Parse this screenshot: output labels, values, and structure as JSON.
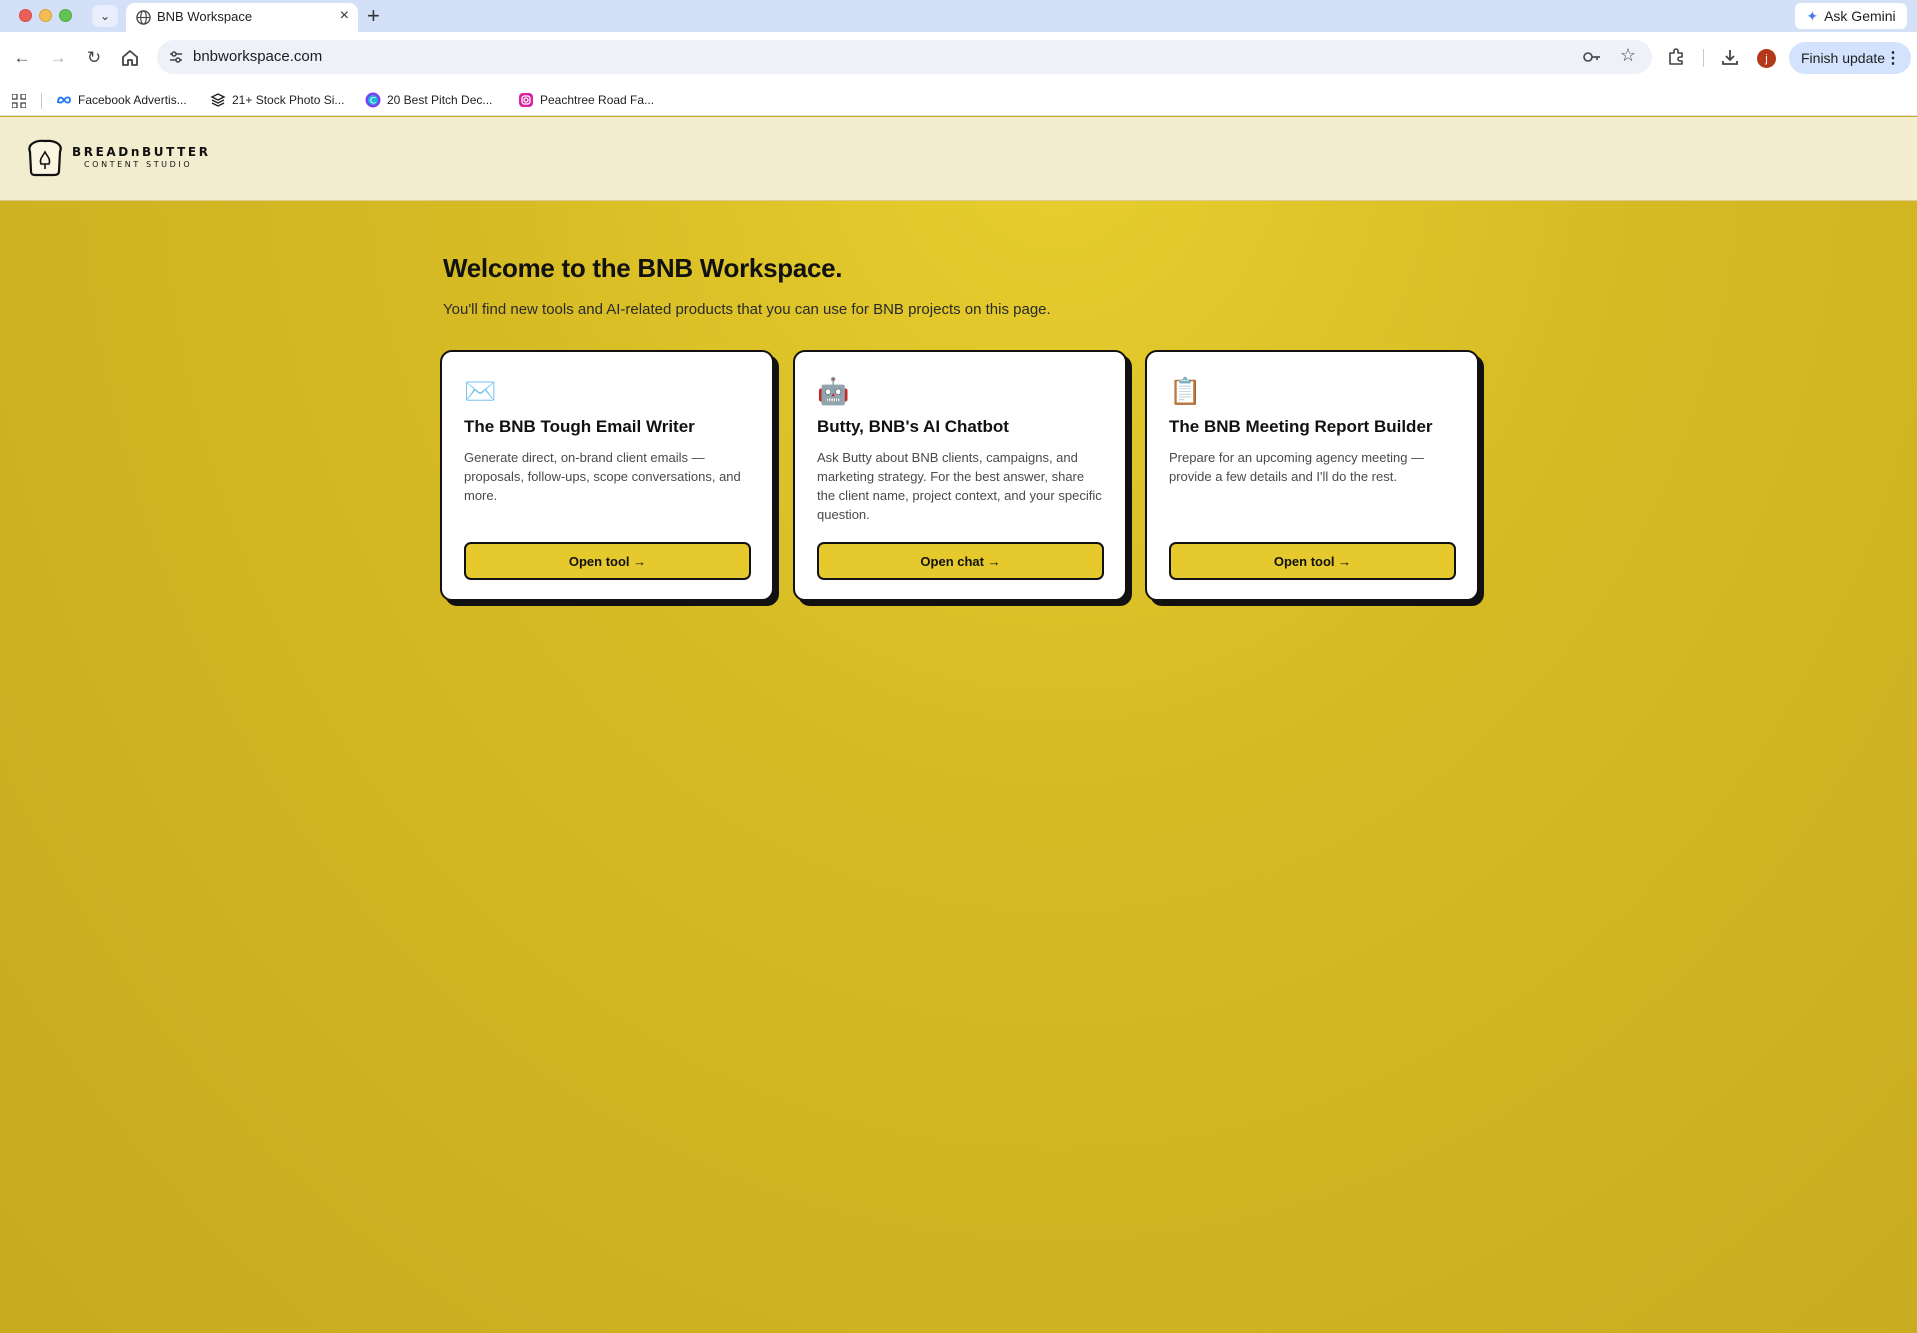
{
  "browser": {
    "tab_title": "BNB Workspace",
    "ask_gemini_label": "Ask Gemini",
    "url": "bnbworkspace.com",
    "finish_update_label": "Finish update",
    "profile_initial": "j",
    "bookmarks": [
      {
        "label": "Facebook Advertis...",
        "icon": "meta-icon"
      },
      {
        "label": "21+ Stock Photo Si...",
        "icon": "stack-icon"
      },
      {
        "label": "20 Best Pitch Dec...",
        "icon": "canva-icon"
      },
      {
        "label": "Peachtree Road Fa...",
        "icon": "instagram-icon"
      }
    ]
  },
  "site": {
    "logo": {
      "line1": "BREADnBUTTER",
      "line2": "CONTENT STUDIO"
    },
    "heading": "Welcome to the BNB Workspace.",
    "intro": "You'll find new tools and AI-related products that you can use for BNB projects on this page.",
    "accent_color": "#e6c92d",
    "cards": [
      {
        "icon": "envelope-icon",
        "emoji": "✉️",
        "title": "The BNB Tough Email Writer",
        "description": "Generate direct, on-brand client emails — proposals, follow-ups, scope conversations, and more.",
        "button": "Open tool →"
      },
      {
        "icon": "robot-icon",
        "emoji": "🤖",
        "title": "Butty, BNB's AI Chatbot",
        "description": "Ask Butty about BNB clients, campaigns, and marketing strategy. For the best answer, share the client name, project context, and your specific question.",
        "button": "Open chat →"
      },
      {
        "icon": "clipboard-icon",
        "emoji": "📋",
        "title": "The BNB Meeting Report Builder",
        "description": "Prepare for an upcoming agency meeting — provide a few details and I'll do the rest.",
        "button": "Open tool →"
      }
    ]
  }
}
